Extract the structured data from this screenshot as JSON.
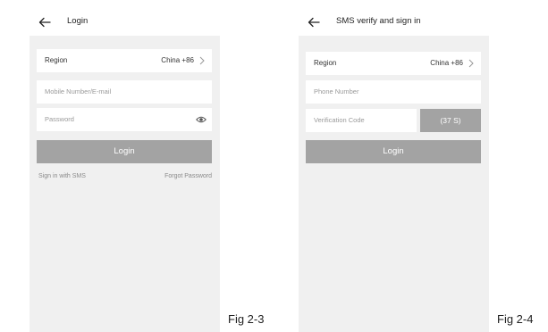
{
  "fig_3": {
    "caption": "Fig 2-3",
    "header": {
      "title": "Login"
    },
    "region": {
      "label": "Region",
      "value": "China +86"
    },
    "account_field": {
      "placeholder": "Mobile Number/E-mail"
    },
    "password_field": {
      "placeholder": "Password"
    },
    "login_label": "Login",
    "sms_link": "Sign in with SMS",
    "forgot_link": "Forgot Password"
  },
  "fig_4": {
    "caption": "Fig 2-4",
    "header": {
      "title": "SMS verify and sign in"
    },
    "region": {
      "label": "Region",
      "value": "China +86"
    },
    "phone_field": {
      "placeholder": "Phone Number"
    },
    "code_field": {
      "placeholder": "Verification Code"
    },
    "countdown_label": "(37 S)",
    "login_label": "Login"
  },
  "icons": [
    "back-arrow-icon",
    "chevron-right-icon",
    "eye-icon"
  ],
  "colors": {
    "screen_background": "#f0f0f0",
    "field_background": "#ffffff",
    "button_background": "#a3a3a3",
    "button_text": "#ffffff",
    "link_text": "#8a8a8a",
    "placeholder_text": "#9a9a9a"
  }
}
